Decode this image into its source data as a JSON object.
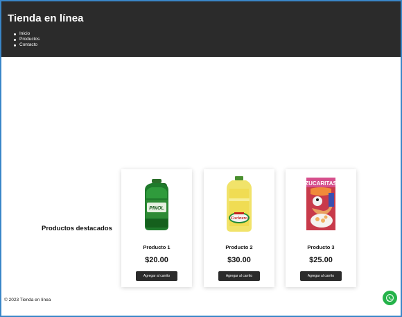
{
  "header": {
    "title": "Tienda en línea",
    "nav": [
      "Inicio",
      "Productos",
      "Contacto"
    ]
  },
  "featured": {
    "title": "Productos destacados",
    "products": [
      {
        "name": "Producto 1",
        "price": "$20.00",
        "button": "Agregar al carrito",
        "image": "pinol-bottle"
      },
      {
        "name": "Producto 2",
        "price": "$30.00",
        "button": "Agregar al carrito",
        "image": "cocinero-oil-bottle"
      },
      {
        "name": "Producto 3",
        "price": "$25.00",
        "button": "Agregar al carrito",
        "image": "zucaritas-cereal-box"
      }
    ]
  },
  "footer": {
    "text": "© 2023 Tienda en línea"
  },
  "whatsapp": {
    "icon": "whatsapp-icon",
    "color": "#25b34a"
  },
  "colors": {
    "header_bg": "#2b2b2b",
    "button_bg": "#2b2b2b"
  }
}
